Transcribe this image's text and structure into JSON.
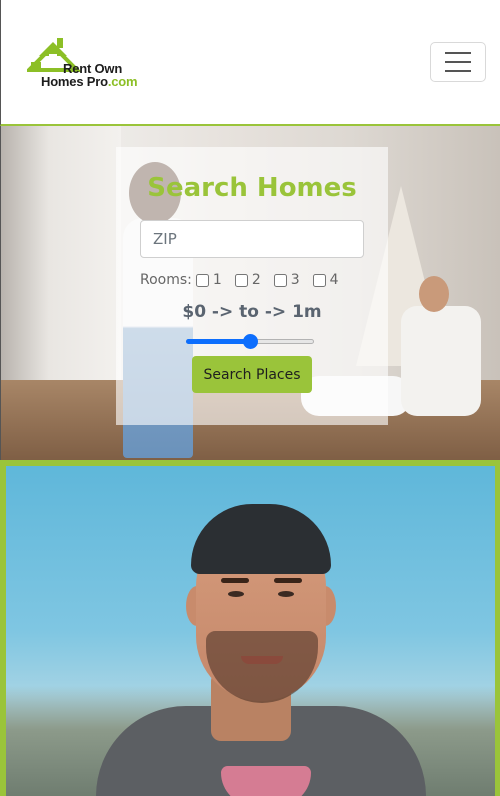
{
  "brand": {
    "line1": "Rent Own",
    "line2_prefix": "Homes Pro",
    "line2_suffix": ".com",
    "accent_color": "#9ac43a"
  },
  "nav": {
    "menu_icon": "hamburger-icon"
  },
  "search": {
    "title": "Search Homes",
    "zip_placeholder": "ZIP",
    "zip_value": "",
    "rooms_label": "Rooms:",
    "room_options": [
      "1",
      "2",
      "3",
      "4"
    ],
    "price_label": "$0 -> to -> 1m",
    "price_slider_fraction": 0.5,
    "button_label": "Search Places"
  },
  "profile": {
    "image_icon": "person-photo"
  }
}
